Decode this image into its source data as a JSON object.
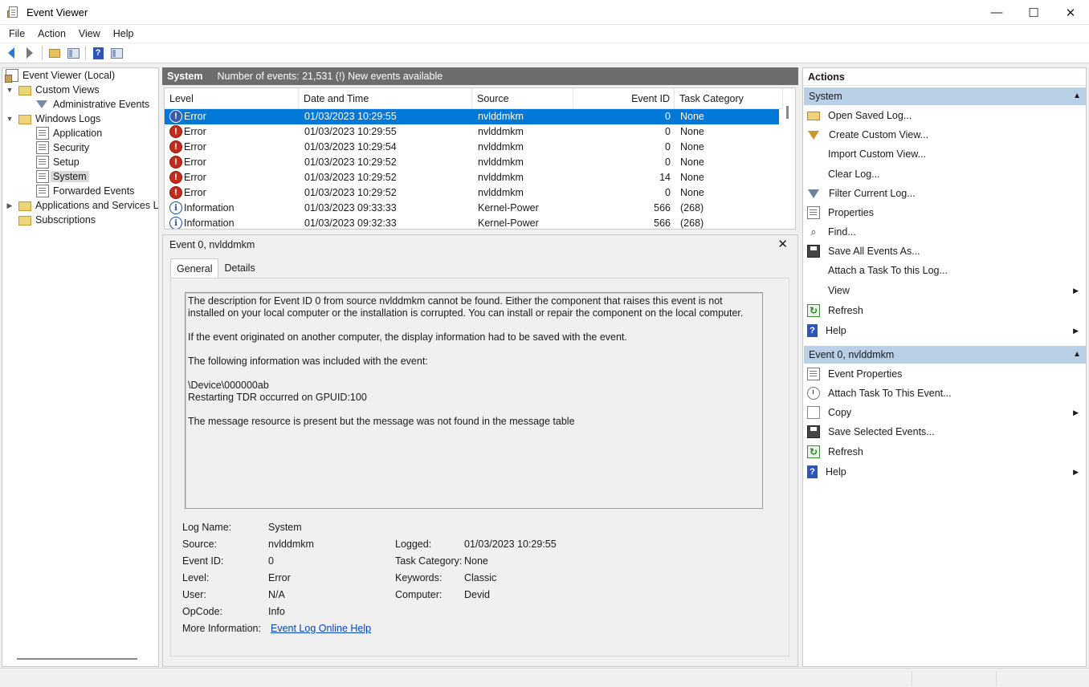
{
  "window": {
    "title": "Event Viewer",
    "minimize_glyph": "—",
    "maximize_glyph": "☐",
    "close_glyph": "✕"
  },
  "menu": [
    "File",
    "Action",
    "View",
    "Help"
  ],
  "tree": {
    "root": "Event Viewer (Local)",
    "custom_views": "Custom Views",
    "administrative_events": "Administrative Events",
    "windows_logs": "Windows Logs",
    "application": "Application",
    "security": "Security",
    "setup": "Setup",
    "system": "System",
    "forwarded_events": "Forwarded Events",
    "apps_services": "Applications and Services Lo",
    "subscriptions": "Subscriptions"
  },
  "center": {
    "header_label": "System",
    "header_info": "Number of events: 21,531 (!) New events available",
    "columns": [
      "Level",
      "Date and Time",
      "Source",
      "Event ID",
      "Task Category"
    ],
    "rows": [
      {
        "level": "Error",
        "datetime": "01/03/2023 10:29:55",
        "source": "nvlddmkm",
        "event_id": "0",
        "category": "None"
      },
      {
        "level": "Error",
        "datetime": "01/03/2023 10:29:55",
        "source": "nvlddmkm",
        "event_id": "0",
        "category": "None"
      },
      {
        "level": "Error",
        "datetime": "01/03/2023 10:29:54",
        "source": "nvlddmkm",
        "event_id": "0",
        "category": "None"
      },
      {
        "level": "Error",
        "datetime": "01/03/2023 10:29:52",
        "source": "nvlddmkm",
        "event_id": "0",
        "category": "None"
      },
      {
        "level": "Error",
        "datetime": "01/03/2023 10:29:52",
        "source": "nvlddmkm",
        "event_id": "14",
        "category": "None"
      },
      {
        "level": "Error",
        "datetime": "01/03/2023 10:29:52",
        "source": "nvlddmkm",
        "event_id": "0",
        "category": "None"
      },
      {
        "level": "Information",
        "datetime": "01/03/2023 09:33:33",
        "source": "Kernel-Power",
        "event_id": "566",
        "category": "(268)"
      },
      {
        "level": "Information",
        "datetime": "01/03/2023 09:32:33",
        "source": "Kernel-Power",
        "event_id": "566",
        "category": "(268)"
      }
    ]
  },
  "detail": {
    "title": "Event 0, nvlddmkm",
    "close_glyph": "✕",
    "tabs": [
      "General",
      "Details"
    ],
    "description": [
      "The description for Event ID 0 from source nvlddmkm cannot be found. Either the component that raises this event is not installed on your local computer or the installation is corrupted. You can install or repair the component on the local computer.",
      "If the event originated on another computer, the display information had to be saved with the event.",
      "The following information was included with the event:",
      "\\Device\\000000ab",
      "Restarting TDR occurred on GPUID:100",
      "The message resource is present but the message was not found in the message table"
    ],
    "fields": {
      "log_name_label": "Log Name:",
      "log_name": "System",
      "source_label": "Source:",
      "source": "nvlddmkm",
      "event_id_label": "Event ID:",
      "event_id": "0",
      "level_label": "Level:",
      "level": "Error",
      "user_label": "User:",
      "user": "N/A",
      "opcode_label": "OpCode:",
      "opcode": "Info",
      "more_info_label": "More Information:",
      "more_info_link": "Event Log Online Help",
      "logged_label": "Logged:",
      "logged": "01/03/2023 10:29:55",
      "task_category_label": "Task Category:",
      "task_category": "None",
      "keywords_label": "Keywords:",
      "keywords": "Classic",
      "computer_label": "Computer:",
      "computer": "Devid"
    }
  },
  "actions": {
    "title": "Actions",
    "section_system": "System",
    "system_items": [
      "Open Saved Log...",
      "Create Custom View...",
      "Import Custom View...",
      "Clear Log...",
      "Filter Current Log...",
      "Properties",
      "Find...",
      "Save All Events As...",
      "Attach a Task To this Log...",
      "View",
      "Refresh",
      "Help"
    ],
    "section_event": "Event 0, nvlddmkm",
    "event_items": [
      "Event Properties",
      "Attach Task To This Event...",
      "Copy",
      "Save Selected Events...",
      "Refresh",
      "Help"
    ]
  },
  "icons": {
    "error": "!",
    "info": "i",
    "help": "?",
    "refresh": "↻",
    "find": "⌕",
    "expanded": "▼",
    "collapsed": "▶",
    "collapse_section": "▲",
    "submenu": "▶"
  },
  "colors": {
    "selection": "#0078d7",
    "section_header": "#b8cfe6",
    "center_header": "#6d6d6d",
    "error": "#c42b1c",
    "link": "#0645ad"
  }
}
